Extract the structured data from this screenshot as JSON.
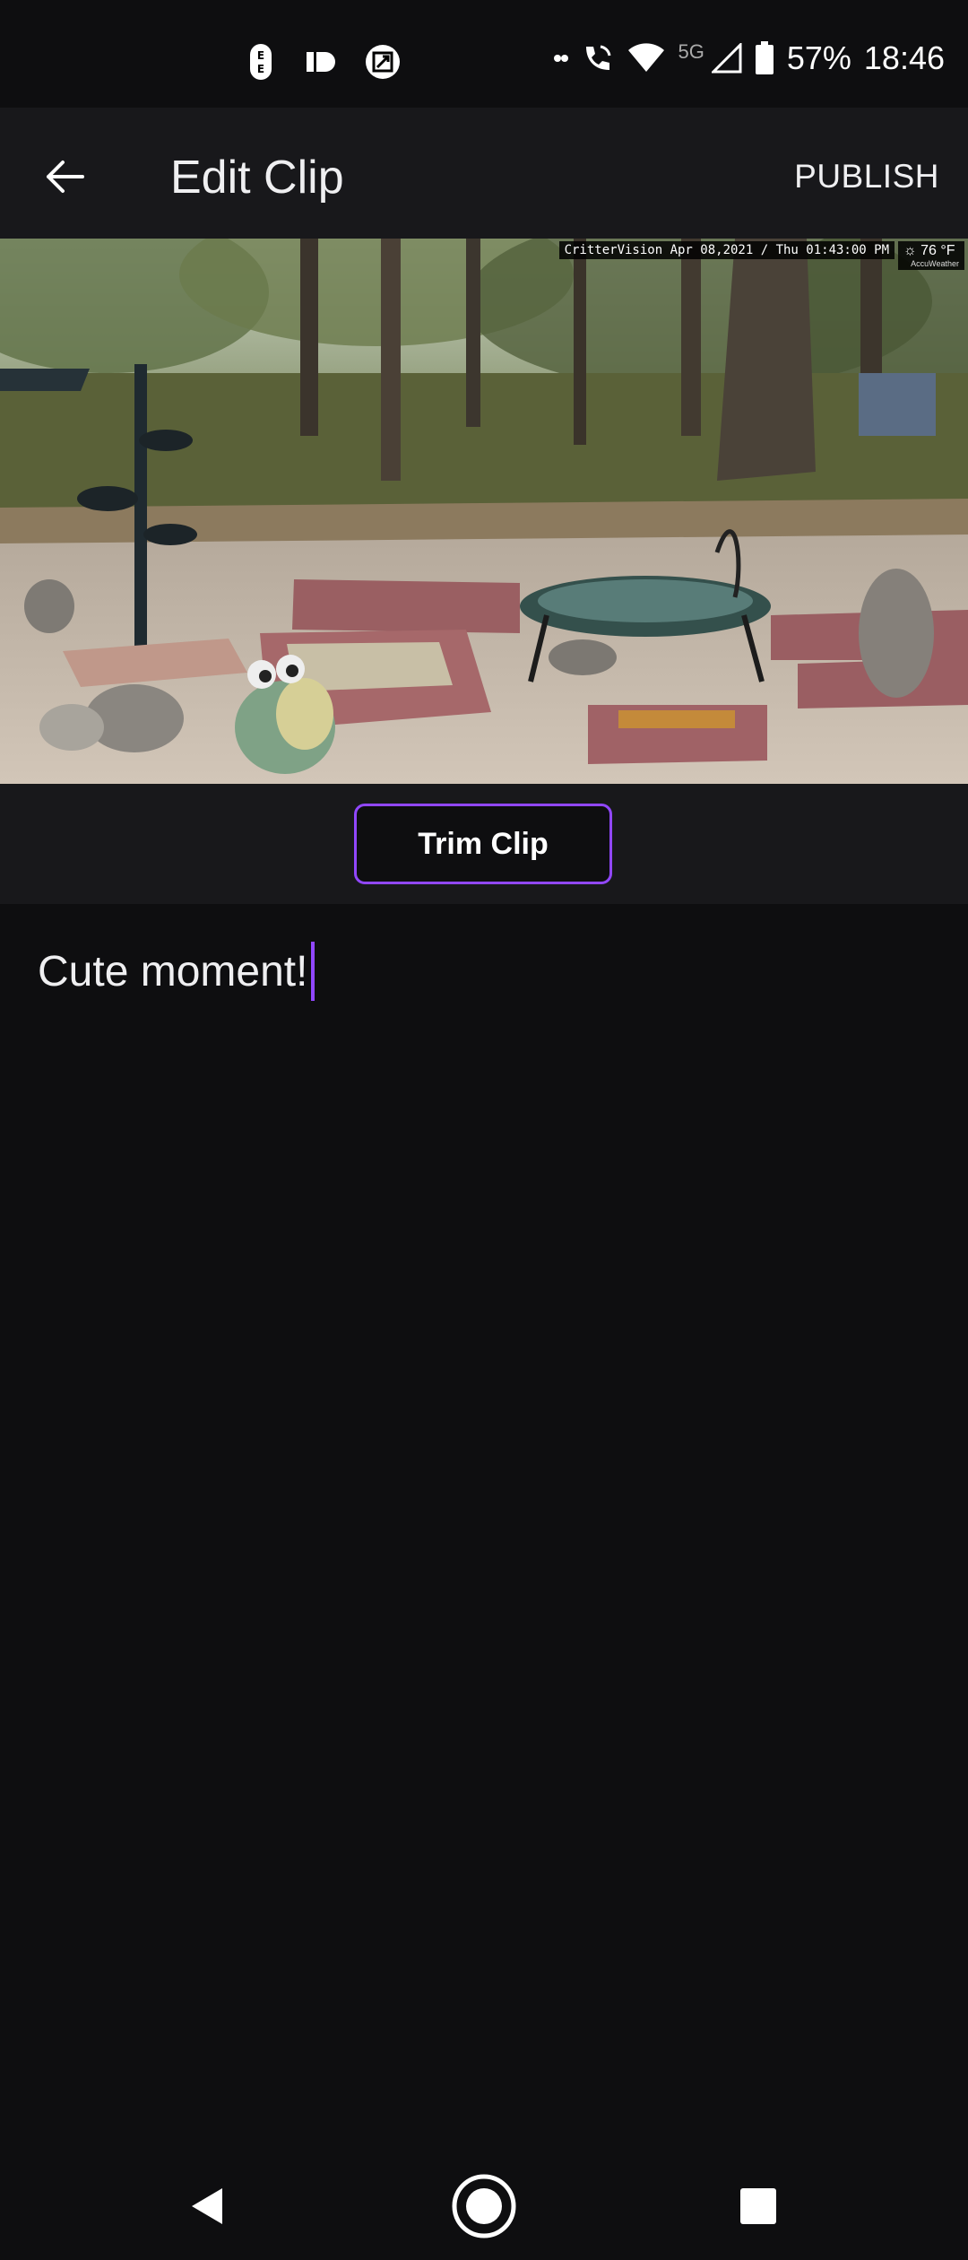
{
  "status_bar": {
    "battery_percent": "57%",
    "time": "18:46",
    "network_label": "5G",
    "icons": [
      "ee-icon",
      "tag-icon",
      "nfc-icon",
      "dots-icon",
      "wifi-call-icon",
      "wifi-icon",
      "signal-icon",
      "battery-icon"
    ]
  },
  "app_bar": {
    "title": "Edit Clip",
    "publish_label": "PUBLISH"
  },
  "video": {
    "overlay_text": "CritterVision Apr 08,2021 / Thu 01:43:00 PM",
    "temperature": "76 °F",
    "weather_brand": "AccuWeather"
  },
  "trim": {
    "label": "Trim Clip"
  },
  "caption": {
    "value": "Cute moment!"
  },
  "colors": {
    "accent": "#9147ff",
    "background": "#0e0e10",
    "surface": "#18181b"
  }
}
